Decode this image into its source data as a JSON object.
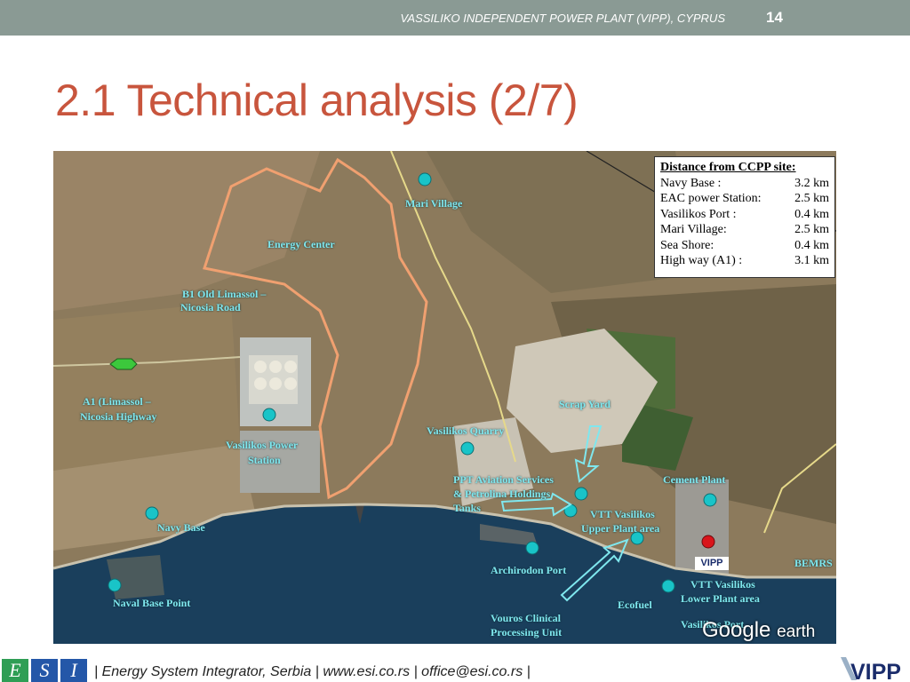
{
  "header": {
    "subject": "VASSILIKO INDEPENDENT POWER PLANT (VIPP), CYPRUS",
    "page_number": "14"
  },
  "title": "2.1 Technical analysis (2/7)",
  "map": {
    "labels": {
      "mari_village": "Mari Village",
      "energy_center": "Energy Center",
      "b1_road_1": "B1 Old  Limassol –",
      "b1_road_2": "Nicosia Road",
      "a1_highway_1": "A1 (Limassol –",
      "a1_highway_2": "Nicosia Highway",
      "power_station_1": "Vasilikos  Power",
      "power_station_2": "Station",
      "quarry": "Vasilikos  Quarry",
      "scrap_yard": "Scrap Yard",
      "ppt_1": "PPT Aviation Services",
      "ppt_2": "& Petrolina Holdings",
      "ppt_3": "Tanks",
      "cement_plant": "Cement Plant",
      "vtt_upper_1": "VTT Vasilikos",
      "vtt_upper_2": "Upper Plant area",
      "navy_base": "Navy Base",
      "archirodon_port": "Archirodon Port",
      "bemr": "BEMRS",
      "vtt_lower_1": "VTT Vasilikos",
      "vtt_lower_2": "Lower Plant area",
      "naval_base_point": "Naval Base Point",
      "ecofuel": "Ecofuel",
      "vouros_1": "Vouros Clinical",
      "vouros_2": "Processing Unit",
      "vasilikos_port": "Vasilikos  Port",
      "vipp_mark": "VIPP"
    },
    "distance_box": {
      "heading": "Distance from CCPP site:",
      "rows": [
        {
          "label": "Navy Base :",
          "value": "3.2 km"
        },
        {
          "label": "EAC power Station:",
          "value": "2.5 km"
        },
        {
          "label": "Vasilikos Port :",
          "value": "0.4 km"
        },
        {
          "label": "Mari Village:",
          "value": "2.5 km"
        },
        {
          "label": "Sea Shore:",
          "value": "0.4 km"
        },
        {
          "label": "High way (A1) :",
          "value": "3.1 km"
        }
      ]
    },
    "watermark_google": "Google",
    "watermark_earth": "earth"
  },
  "footer": {
    "logo_letters": [
      "E",
      "S",
      "I"
    ],
    "text": "| Energy System Integrator, Serbia | www.esi.co.rs | office@esi.co.rs |",
    "vipp_logo": "VIPP"
  },
  "colors": {
    "title": "#c8553d",
    "topbar": "#8a9a94",
    "map_label": "#7fe7ee",
    "site_boundary": "#f0a070",
    "sea": "#1a3f5c",
    "site_marker": "#d9151b"
  }
}
